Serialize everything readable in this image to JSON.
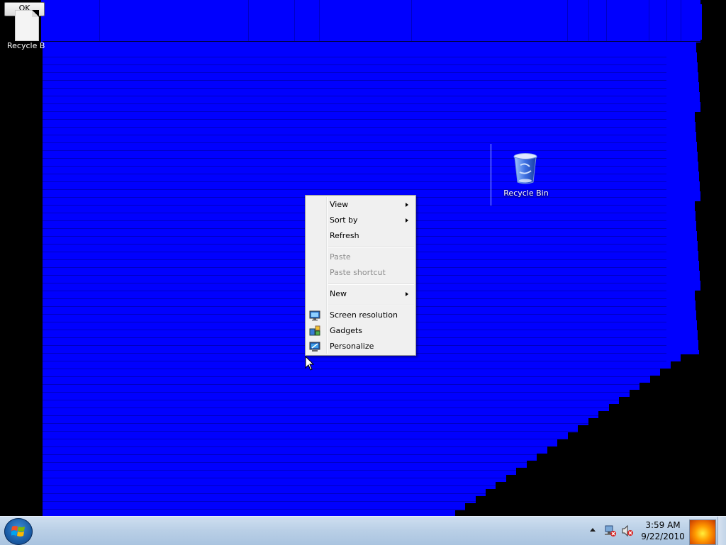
{
  "desktop": {
    "ghost_icon": {
      "ok_label": "OK",
      "label": "Recycle B"
    },
    "recycle_bin": {
      "label": "Recycle Bin"
    }
  },
  "context_menu": {
    "items": [
      {
        "label": "View",
        "submenu": true,
        "enabled": true
      },
      {
        "label": "Sort by",
        "submenu": true,
        "enabled": true
      },
      {
        "label": "Refresh",
        "submenu": false,
        "enabled": true
      },
      {
        "label": "Paste",
        "submenu": false,
        "enabled": false
      },
      {
        "label": "Paste shortcut",
        "submenu": false,
        "enabled": false
      },
      {
        "label": "New",
        "submenu": true,
        "enabled": true
      },
      {
        "label": "Screen resolution",
        "submenu": false,
        "enabled": true,
        "icon": "monitor-icon"
      },
      {
        "label": "Gadgets",
        "submenu": false,
        "enabled": true,
        "icon": "gadgets-icon"
      },
      {
        "label": "Personalize",
        "submenu": false,
        "enabled": true,
        "icon": "personalize-icon"
      }
    ]
  },
  "taskbar": {
    "clock": {
      "time": "3:59 AM",
      "date": "9/22/2010"
    },
    "tray_icons": [
      "show-hidden-icons-arrow",
      "network-disconnected-icon",
      "volume-muted-icon"
    ]
  },
  "colors": {
    "desktop_blue": "#0000fe",
    "background_black": "#000000",
    "menu_bg": "#f0f0f0",
    "disabled_text": "#8d8d8d"
  }
}
